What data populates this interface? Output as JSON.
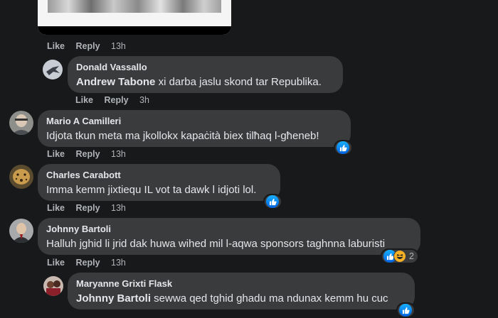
{
  "theme": {
    "background": "#18191a",
    "bubble": "#3a3b3c",
    "like_blue": "#1877f2"
  },
  "top_actions": {
    "like": "Like",
    "reply": "Reply",
    "time": "13h"
  },
  "comments": [
    {
      "author": "Donald Vassallo",
      "tag": "Andrew Tabone",
      "text": " xi darba jaslu skond tar Republika.",
      "like": "Like",
      "reply": "Reply",
      "time": "3h"
    },
    {
      "author": "Mario A Camilleri",
      "text": "Idjota tkun meta ma jkollokx kapaċità biex tilħaq l-għeneb!",
      "like": "Like",
      "reply": "Reply",
      "time": "13h",
      "reactions": [
        "like-icon"
      ]
    },
    {
      "author": "Charles Carabott",
      "text": "Imma kemm jixtiequ IL vot ta dawk l idjoti lol.",
      "like": "Like",
      "reply": "Reply",
      "time": "13h",
      "reactions": [
        "like-icon"
      ]
    },
    {
      "author": "Johnny Bartoli",
      "text": "Halluh jghid li jrid dak huwa wihed mil l-aqwa sponsors taghnna laburisti",
      "like": "Like",
      "reply": "Reply",
      "time": "13h",
      "reactions": [
        "like-icon",
        "haha-icon"
      ],
      "reaction_count": "2"
    },
    {
      "author": "Maryanne Grixti Flask",
      "tag": "Johnny Bartoli",
      "text": " sewwa qed tghid ghadu ma ndunax kemm hu cuc",
      "reactions": [
        "like-icon"
      ]
    }
  ]
}
